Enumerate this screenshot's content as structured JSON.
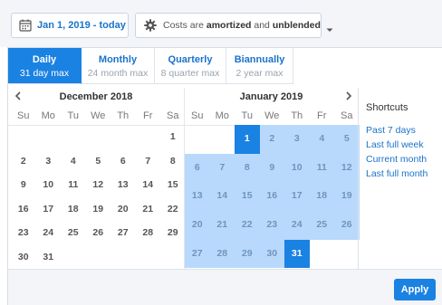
{
  "toolbar": {
    "date_range_label": "Jan 1, 2019 - today",
    "cost_prefix": "Costs are",
    "cost_mode_1": "amortized",
    "cost_middle": "and",
    "cost_mode_2": "unblended"
  },
  "tabs": [
    {
      "title": "Daily",
      "subtitle": "31 day max",
      "active": true
    },
    {
      "title": "Monthly",
      "subtitle": "24 month max",
      "active": false
    },
    {
      "title": "Quarterly",
      "subtitle": "8 quarter max",
      "active": false
    },
    {
      "title": "Biannually",
      "subtitle": "2 year max",
      "active": false
    }
  ],
  "calendar": {
    "prev_icon": "chevron-left-icon",
    "next_icon": "chevron-right-icon",
    "left_month": "December 2018",
    "right_month": "January 2019",
    "weekdays": [
      "Su",
      "Mo",
      "Tu",
      "We",
      "Th",
      "Fr",
      "Sa"
    ],
    "left_weeks": [
      [
        "",
        "",
        "",
        "",
        "",
        "",
        "1"
      ],
      [
        "2",
        "3",
        "4",
        "5",
        "6",
        "7",
        "8"
      ],
      [
        "9",
        "10",
        "11",
        "12",
        "13",
        "14",
        "15"
      ],
      [
        "16",
        "17",
        "18",
        "19",
        "20",
        "21",
        "22"
      ],
      [
        "23",
        "24",
        "25",
        "26",
        "27",
        "28",
        "29"
      ],
      [
        "30",
        "31",
        "",
        "",
        "",
        "",
        ""
      ]
    ],
    "right_weeks": [
      [
        "",
        "",
        "1",
        "2",
        "3",
        "4",
        "5"
      ],
      [
        "6",
        "7",
        "8",
        "9",
        "10",
        "11",
        "12"
      ],
      [
        "13",
        "14",
        "15",
        "16",
        "17",
        "18",
        "19"
      ],
      [
        "20",
        "21",
        "22",
        "23",
        "24",
        "25",
        "26"
      ],
      [
        "27",
        "28",
        "29",
        "30",
        "31",
        "",
        ""
      ]
    ],
    "range_start": "1",
    "range_end": "31"
  },
  "shortcuts": {
    "title": "Shortcuts",
    "items": [
      "Past 7 days",
      "Last full week",
      "Current month",
      "Last full month"
    ]
  },
  "footer": {
    "apply_label": "Apply"
  },
  "colors": {
    "accent": "#1a82e2",
    "range": "#b8d9fb",
    "link": "#1a73c9"
  }
}
